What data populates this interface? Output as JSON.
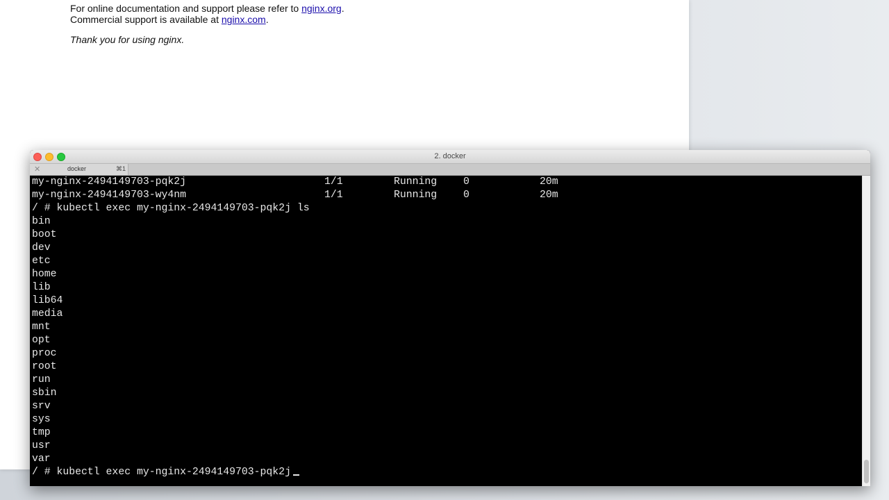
{
  "browser": {
    "line1_text": "For online documentation and support please refer to ",
    "line1_link": "nginx.org",
    "line1_end": ".",
    "line2_text": "Commercial support is available at ",
    "line2_link": "nginx.com",
    "line2_end": ".",
    "line3_text": "Thank you for using nginx."
  },
  "terminal": {
    "window_title": "2. docker",
    "tab": {
      "close_glyph": "✕",
      "title": "docker",
      "shortcut": "⌘1"
    },
    "pods": [
      {
        "name": "my-nginx-2494149703-pqk2j",
        "ready": "1/1",
        "status": "Running",
        "restarts": "0",
        "age": "20m"
      },
      {
        "name": "my-nginx-2494149703-wy4nm",
        "ready": "1/1",
        "status": "Running",
        "restarts": "0",
        "age": "20m"
      }
    ],
    "command1": "/ # kubectl exec my-nginx-2494149703-pqk2j ls",
    "listing": [
      "bin",
      "boot",
      "dev",
      "etc",
      "home",
      "lib",
      "lib64",
      "media",
      "mnt",
      "opt",
      "proc",
      "root",
      "run",
      "sbin",
      "srv",
      "sys",
      "tmp",
      "usr",
      "var"
    ],
    "prompt_current": "/ # kubectl exec my-nginx-2494149703-pqk2j"
  },
  "colors": {
    "close": "#fc5f57",
    "minimize": "#fdbc2e",
    "maximize": "#28c840",
    "terminal_bg": "#000000",
    "terminal_fg": "#e8e8e8",
    "link": "#1a0dab"
  }
}
